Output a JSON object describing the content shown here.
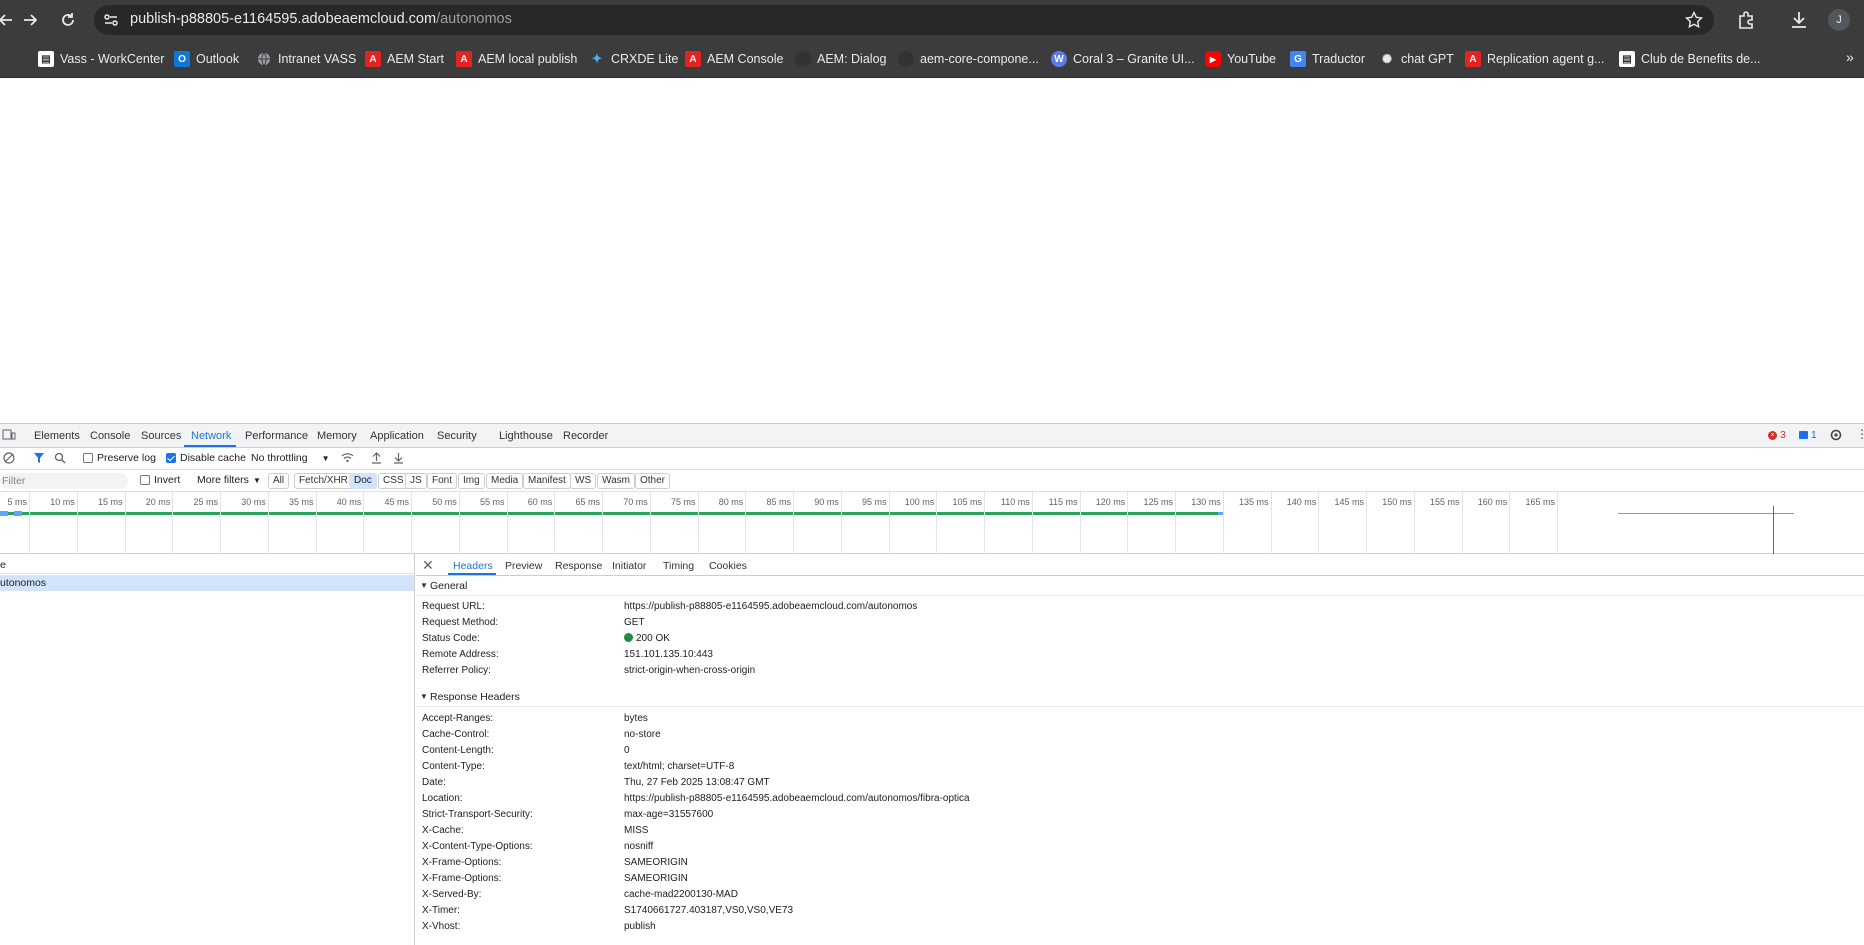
{
  "browser": {
    "url_host": "publish-p88805-e1164595.adobeaemcloud.com",
    "url_path": "/autonomos",
    "profile_initial": "J"
  },
  "bookmarks": [
    {
      "label": "Vass - WorkCenter",
      "icon": "document-icon",
      "color": "#ffffff"
    },
    {
      "label": "Outlook",
      "icon": "outlook-icon",
      "color": "#0f78d4"
    },
    {
      "label": "Intranet VASS",
      "icon": "globe-icon",
      "color": "#9aa0a6"
    },
    {
      "label": "AEM Start",
      "icon": "adobe-icon",
      "color": "#e52222"
    },
    {
      "label": "AEM local publish",
      "icon": "adobe-icon",
      "color": "#e52222"
    },
    {
      "label": "CRXDE Lite",
      "icon": "crxde-icon",
      "color": "#4ab1e4"
    },
    {
      "label": "AEM Console",
      "icon": "adobe-icon",
      "color": "#e52222"
    },
    {
      "label": "AEM: Dialog",
      "icon": "github-icon",
      "color": "#333333"
    },
    {
      "label": "aem-core-compone...",
      "icon": "github-icon",
      "color": "#333333"
    },
    {
      "label": "Coral 3 – Granite UI...",
      "icon": "wordpress-icon",
      "color": "#5a7ee6"
    },
    {
      "label": "YouTube",
      "icon": "youtube-icon",
      "color": "#ff0000"
    },
    {
      "label": "Traductor",
      "icon": "translate-icon",
      "color": "#4285f4"
    },
    {
      "label": "chat GPT",
      "icon": "openai-icon",
      "color": "#3c3c3c"
    },
    {
      "label": "Replication agent g...",
      "icon": "adobe-icon",
      "color": "#e52222"
    },
    {
      "label": "Club de Benefits de...",
      "icon": "document-icon",
      "color": "#ffffff"
    }
  ],
  "devtools": {
    "tabs": [
      "Elements",
      "Console",
      "Sources",
      "Network",
      "Performance",
      "Memory",
      "Application",
      "Security",
      "Lighthouse",
      "Recorder"
    ],
    "active_tab": "Network",
    "error_count": "3",
    "message_count": "1",
    "toolbar": {
      "preserve_log": "Preserve log",
      "disable_cache": "Disable cache",
      "throttling": "No throttling"
    },
    "filter": {
      "placeholder": "Filter",
      "invert": "Invert",
      "more_filters": "More filters",
      "types": [
        "All",
        "Fetch/XHR",
        "Doc",
        "CSS",
        "JS",
        "Font",
        "Img",
        "Media",
        "Manifest",
        "WS",
        "Wasm",
        "Other"
      ],
      "active_type": "Doc"
    },
    "timeline_ticks": [
      "5 ms",
      "10 ms",
      "15 ms",
      "20 ms",
      "25 ms",
      "30 ms",
      "35 ms",
      "40 ms",
      "45 ms",
      "50 ms",
      "55 ms",
      "60 ms",
      "65 ms",
      "70 ms",
      "75 ms",
      "80 ms",
      "85 ms",
      "90 ms",
      "95 ms",
      "100 ms",
      "105 ms",
      "110 ms",
      "115 ms",
      "120 ms",
      "125 ms",
      "130 ms",
      "135 ms",
      "140 ms",
      "145 ms",
      "150 ms",
      "155 ms",
      "160 ms",
      "165 ms"
    ],
    "request_list": {
      "header": "e",
      "rows": [
        "utonomos"
      ]
    },
    "details": {
      "tabs": [
        "Headers",
        "Preview",
        "Response",
        "Initiator",
        "Timing",
        "Cookies"
      ],
      "active_tab": "Headers",
      "general_title": "General",
      "general": [
        {
          "k": "Request URL:",
          "v": "https://publish-p88805-e1164595.adobeaemcloud.com/autonomos"
        },
        {
          "k": "Request Method:",
          "v": "GET"
        },
        {
          "k": "Status Code:",
          "v": "200 OK"
        },
        {
          "k": "Remote Address:",
          "v": "151.101.135.10:443"
        },
        {
          "k": "Referrer Policy:",
          "v": "strict-origin-when-cross-origin"
        }
      ],
      "response_title": "Response Headers",
      "response": [
        {
          "k": "Accept-Ranges:",
          "v": "bytes"
        },
        {
          "k": "Cache-Control:",
          "v": "no-store"
        },
        {
          "k": "Content-Length:",
          "v": "0"
        },
        {
          "k": "Content-Type:",
          "v": "text/html; charset=UTF-8"
        },
        {
          "k": "Date:",
          "v": "Thu, 27 Feb 2025 13:08:47 GMT"
        },
        {
          "k": "Location:",
          "v": "https://publish-p88805-e1164595.adobeaemcloud.com/autonomos/fibra-optica"
        },
        {
          "k": "Strict-Transport-Security:",
          "v": "max-age=31557600"
        },
        {
          "k": "X-Cache:",
          "v": "MISS"
        },
        {
          "k": "X-Content-Type-Options:",
          "v": "nosniff"
        },
        {
          "k": "X-Frame-Options:",
          "v": "SAMEORIGIN"
        },
        {
          "k": "X-Frame-Options:",
          "v": "SAMEORIGIN"
        },
        {
          "k": "X-Served-By:",
          "v": "cache-mad2200130-MAD"
        },
        {
          "k": "X-Timer:",
          "v": "S1740661727.403187,VS0,VS0,VE73"
        },
        {
          "k": "X-Vhost:",
          "v": "publish"
        }
      ]
    }
  }
}
